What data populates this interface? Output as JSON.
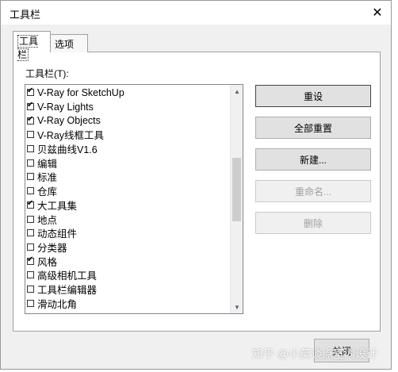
{
  "dialog": {
    "title": "工具栏"
  },
  "tabs": [
    {
      "label": "工具栏"
    },
    {
      "label": "选项"
    }
  ],
  "panel": {
    "list_label": "工具栏(T):",
    "items": [
      {
        "label": "V-Ray for SketchUp",
        "checked": true
      },
      {
        "label": "V-Ray Lights",
        "checked": true
      },
      {
        "label": "V-Ray Objects",
        "checked": true
      },
      {
        "label": "V-Ray线框工具",
        "checked": false
      },
      {
        "label": "贝兹曲线V1.6",
        "checked": false
      },
      {
        "label": "编辑",
        "checked": false
      },
      {
        "label": "标准",
        "checked": false
      },
      {
        "label": "仓库",
        "checked": false
      },
      {
        "label": "大工具集",
        "checked": true
      },
      {
        "label": "地点",
        "checked": false
      },
      {
        "label": "动态组件",
        "checked": false
      },
      {
        "label": "分类器",
        "checked": false
      },
      {
        "label": "风格",
        "checked": true
      },
      {
        "label": "高级相机工具",
        "checked": false
      },
      {
        "label": "工具栏编辑器",
        "checked": false
      },
      {
        "label": "滑动北角",
        "checked": false
      }
    ],
    "buttons": {
      "reset": "重设",
      "reset_all": "全部重置",
      "new": "新建...",
      "rename": "重命名...",
      "delete": "删除"
    }
  },
  "close_button": "关闭",
  "watermark": "知乎 @小莫谈点室内设计"
}
